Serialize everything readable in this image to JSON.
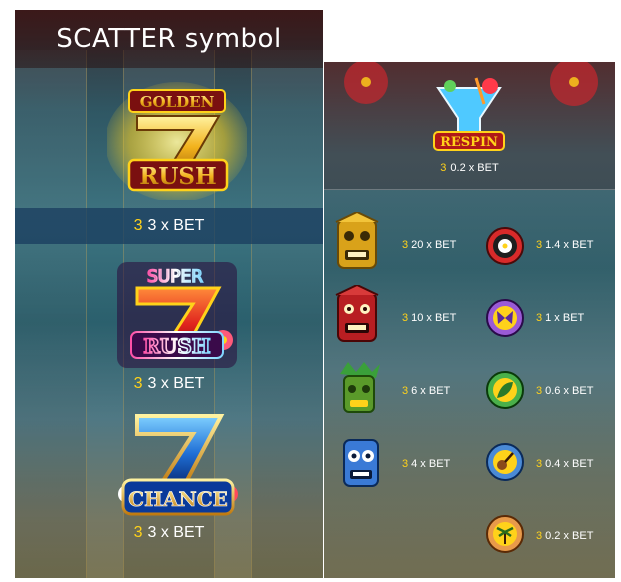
{
  "scatter_panel": {
    "title": "SCATTER symbol",
    "symbols": [
      {
        "name": "GOLDEN 7 RUSH",
        "count": "3",
        "payout": "3 x BET"
      },
      {
        "name": "SUPER 7 RUSH",
        "count": "3",
        "payout": "3 x BET"
      },
      {
        "name": "7 CHANCE",
        "count": "3",
        "payout": "3 x BET"
      }
    ]
  },
  "respin_panel": {
    "respin": {
      "label": "RESPIN",
      "count": "3",
      "payout": "0.2 x BET"
    },
    "tiki_symbols": [
      {
        "name": "gold tiki mask",
        "count": "3",
        "payout": "20 x BET"
      },
      {
        "name": "red tiki mask",
        "count": "3",
        "payout": "10 x BET"
      },
      {
        "name": "green tiki mask",
        "count": "3",
        "payout": "6 x BET"
      },
      {
        "name": "blue tiki mask",
        "count": "3",
        "payout": "4 x BET"
      }
    ],
    "coin_symbols": [
      {
        "name": "red hibiscus coin",
        "count": "3",
        "payout": "1.4 x BET"
      },
      {
        "name": "purple butterfly coin",
        "count": "3",
        "payout": "1 x BET"
      },
      {
        "name": "green leaf coin",
        "count": "3",
        "payout": "0.6 x BET"
      },
      {
        "name": "blue guitar coin",
        "count": "3",
        "payout": "0.4 x BET"
      },
      {
        "name": "orange palm coin",
        "count": "3",
        "payout": "0.2 x BET"
      }
    ]
  },
  "colors": {
    "count_yellow": "#ffd21a",
    "gold": "#f2b21c",
    "red": "#d8242a",
    "blue": "#1f6fd6",
    "pink": "#ff4fa8"
  }
}
